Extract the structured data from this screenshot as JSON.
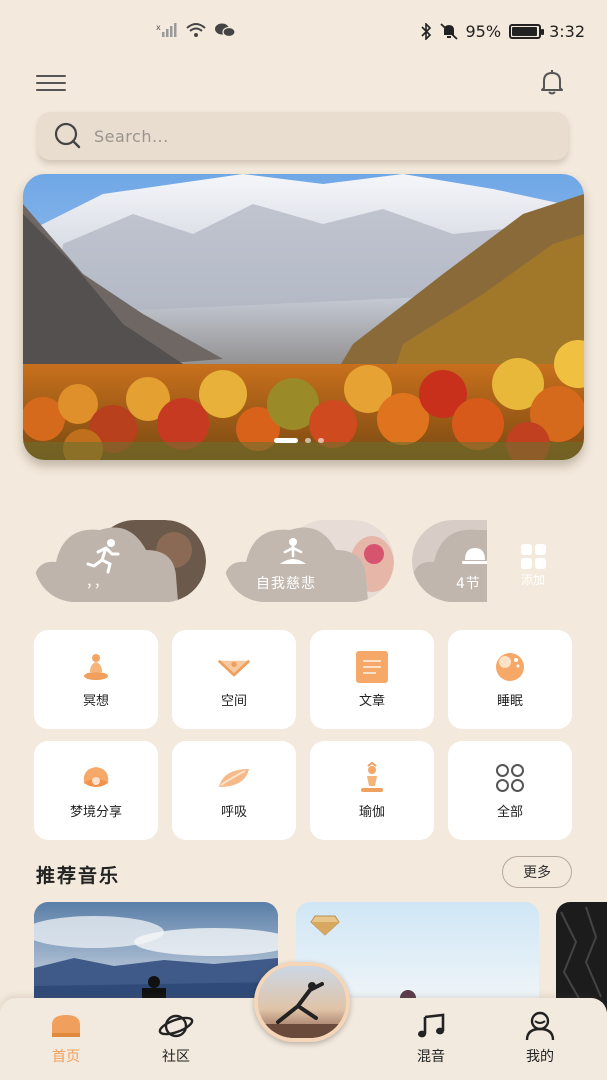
{
  "status_bar": {
    "battery": "95%",
    "time": "3:32",
    "battery_level": 0.95
  },
  "search": {
    "placeholder": "Search..."
  },
  "banner": {
    "slides": 3,
    "active_slide": 1
  },
  "quick_items": [
    {
      "label": "，，",
      "icon": "running-icon"
    },
    {
      "label": "自我慈悲",
      "icon": "meditation-icon"
    },
    {
      "label": "4节",
      "icon": "bell-tray-icon"
    }
  ],
  "add_button": {
    "label": "添加"
  },
  "categories": [
    {
      "label": "冥想",
      "icon": "meditation-icon"
    },
    {
      "label": "空间",
      "icon": "bowl-icon"
    },
    {
      "label": "文章",
      "icon": "article-icon"
    },
    {
      "label": "睡眠",
      "icon": "moon-icon"
    },
    {
      "label": "梦境分享",
      "icon": "shell-icon"
    },
    {
      "label": "呼吸",
      "icon": "leaf-icon"
    },
    {
      "label": "瑜伽",
      "icon": "yoga-icon"
    },
    {
      "label": "全部",
      "icon": "clover-icon"
    }
  ],
  "recommend": {
    "title": "推荐音乐",
    "more_label": "更多"
  },
  "tabbar": {
    "items": [
      {
        "label": "首页",
        "icon": "home-icon",
        "active": true
      },
      {
        "label": "社区",
        "icon": "planet-icon",
        "active": false
      },
      {
        "label": "混音",
        "icon": "music-note-icon",
        "active": false
      },
      {
        "label": "我的",
        "icon": "profile-icon",
        "active": false
      }
    ]
  },
  "colors": {
    "background": "#f3e9dc",
    "accent": "#f0a05c",
    "card": "#ffffff"
  }
}
